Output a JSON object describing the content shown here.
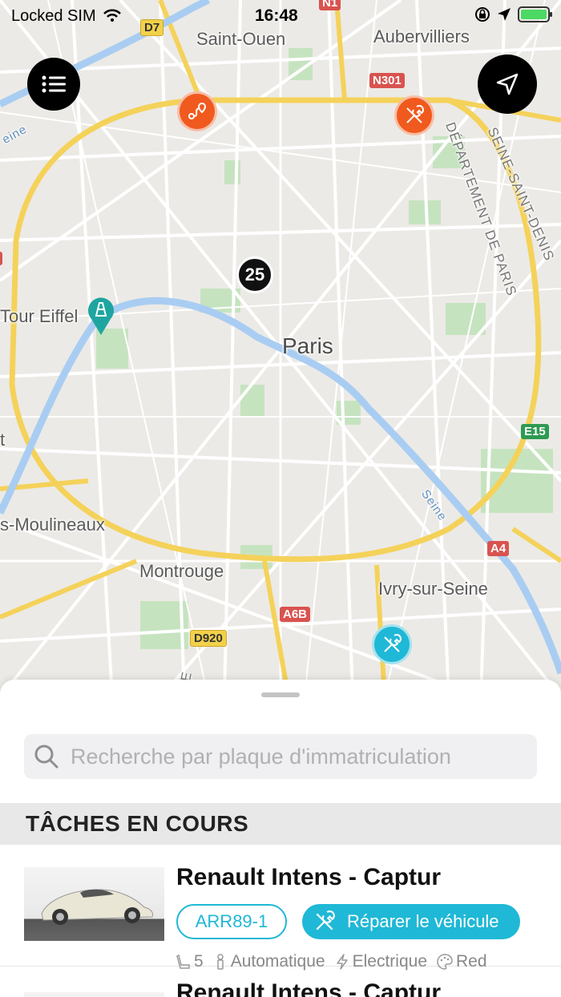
{
  "status_bar": {
    "carrier": "Locked SIM",
    "time": "16:48"
  },
  "map": {
    "labels": {
      "saint_ouen": "Saint-Ouen",
      "aubervilliers": "Aubervilliers",
      "paris": "Paris",
      "tour_eiffel": "Tour Eiffel",
      "moulineaux": "s-Moulineaux",
      "montrouge": "Montrouge",
      "ivry": "Ivry-sur-Seine",
      "seine": "Seine",
      "dept_paris": "DÉPARTEMENT DE PARIS",
      "seine_st_denis": "SEINE-SAINT-DENIS",
      "edge_t": "t",
      "edge_e": "E",
      "edge_5": "5",
      "edge_eine": "eine"
    },
    "road_badges": {
      "d7": "D7",
      "n1": "N1",
      "n301": "N301",
      "e15": "E15",
      "a4": "A4",
      "a6b": "A6B",
      "d920": "D920"
    },
    "cluster_count": "25"
  },
  "sheet": {
    "search_placeholder": "Recherche par plaque d'immatriculation",
    "section_title": "TÂCHES EN COURS",
    "tasks": [
      {
        "title": "Renault Intens - Captur",
        "plate": "ARR89-1",
        "action": "Réparer le véhicule",
        "seats": "5",
        "transmission": "Automatique",
        "energy": "Electrique",
        "color": "Red"
      },
      {
        "title": "Renault Intens - Captur"
      }
    ]
  },
  "colors": {
    "accent": "#1fb8d6",
    "pin_orange": "#f05a1e"
  }
}
